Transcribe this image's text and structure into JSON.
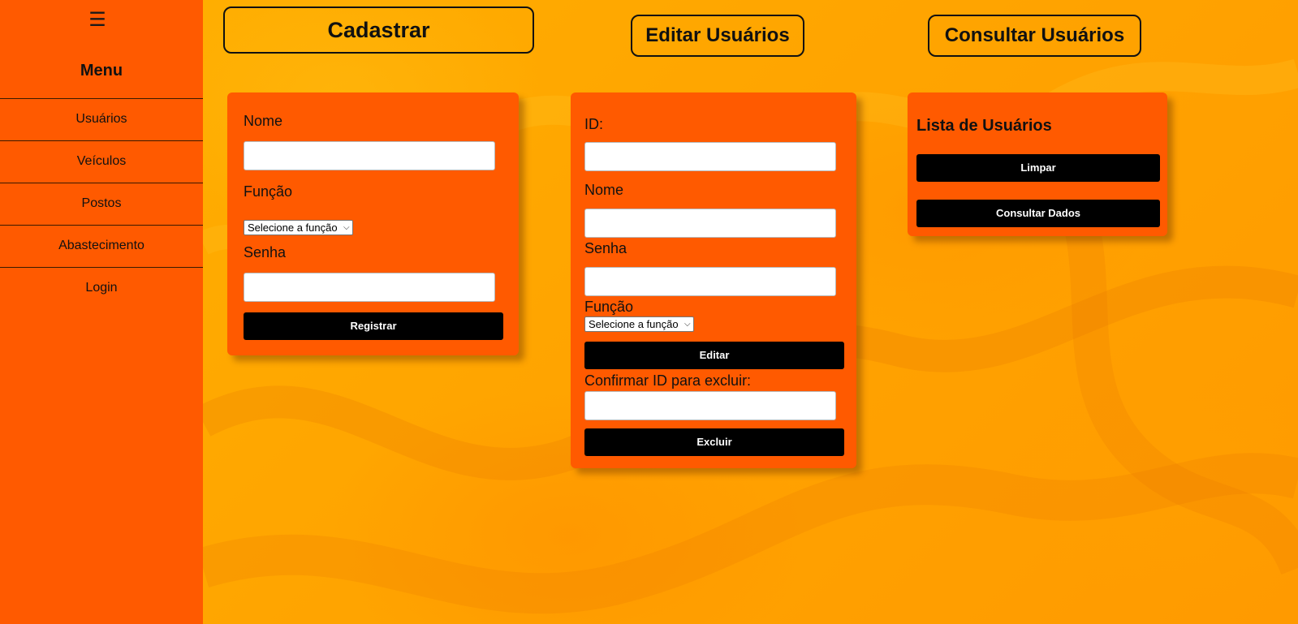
{
  "sidebar": {
    "toggle_icon": "☰",
    "title": "Menu",
    "items": [
      {
        "label": "Usuários"
      },
      {
        "label": "Veículos"
      },
      {
        "label": "Postos"
      },
      {
        "label": "Abastecimento"
      },
      {
        "label": "Login"
      }
    ]
  },
  "header": {
    "cadastrar": "Cadastrar",
    "editar": "Editar Usuários",
    "consultar": "Consultar Usuários"
  },
  "cadastrar_form": {
    "nome_label": "Nome",
    "nome_value": "",
    "funcao_label": "Função",
    "funcao_selected": "Selecione a função",
    "senha_label": "Senha",
    "senha_value": "",
    "submit_label": "Registrar"
  },
  "editar_form": {
    "id_label": "ID:",
    "id_value": "",
    "nome_label": "Nome",
    "nome_value": "",
    "senha_label": "Senha",
    "senha_value": "",
    "funcao_label": "Função",
    "funcao_selected": "Selecione a função",
    "editar_label": "Editar",
    "confirm_label": "Confirmar ID para excluir:",
    "confirm_value": "",
    "excluir_label": "Excluir"
  },
  "consultar_panel": {
    "title": "Lista de Usuários",
    "limpar_label": "Limpar",
    "consultar_label": "Consultar Dados"
  },
  "colors": {
    "sidebar_bg": "#ff5a00",
    "panel_bg": "#ff5a00",
    "page_bg": "#ffaa00",
    "button_bg": "#000000"
  }
}
